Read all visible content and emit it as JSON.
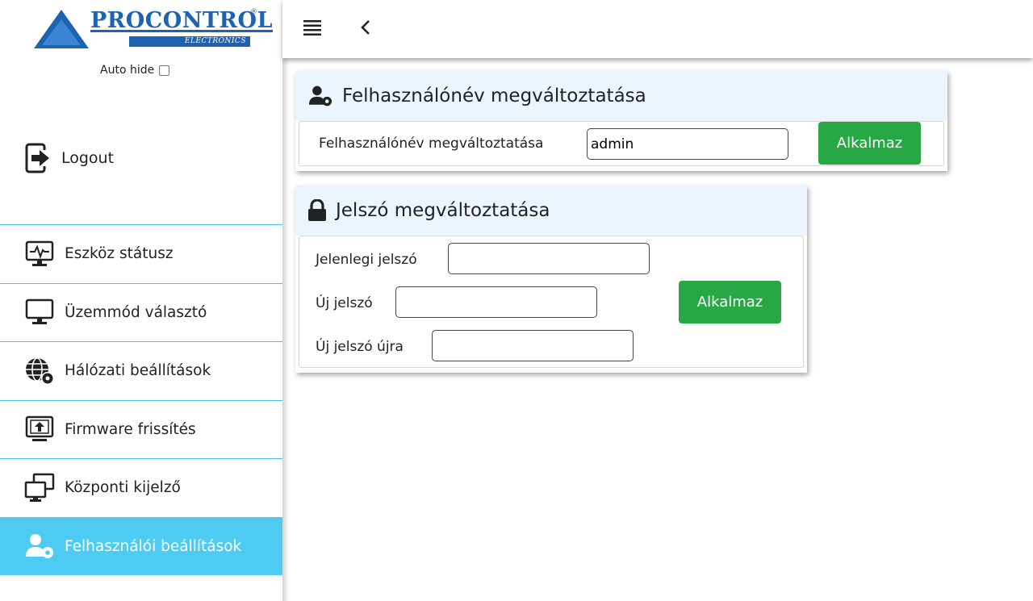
{
  "logo": {
    "brand": "PROCONTROL",
    "subtitle": "ELECTRONICS",
    "registered": "®"
  },
  "sidebar": {
    "autohide_label": "Auto hide",
    "logout_label": "Logout",
    "items": [
      {
        "label": "Eszköz státusz",
        "icon": "monitor-pulse-icon"
      },
      {
        "label": "Üzemmód választó",
        "icon": "monitor-icon"
      },
      {
        "label": "Hálózati beállítások",
        "icon": "globe-gear-icon"
      },
      {
        "label": "Firmware frissítés",
        "icon": "monitor-upload-icon"
      },
      {
        "label": "Központi kijelző",
        "icon": "dual-monitor-icon"
      },
      {
        "label": "Felhasználói beállítások",
        "icon": "user-gear-icon",
        "active": true
      }
    ]
  },
  "username_card": {
    "title": "Felhasználónév megváltoztatása",
    "field_label": "Felhasználónév megváltoztatása",
    "value": "admin",
    "button": "Alkalmaz"
  },
  "password_card": {
    "title": "Jelszó megváltoztatása",
    "current_label": "Jelenlegi jelszó",
    "new_label": "Új jelszó",
    "repeat_label": "Új jelszó újra",
    "button": "Alkalmaz"
  },
  "colors": {
    "accent": "#4ecbf3",
    "divider": "#47c3ea",
    "button": "#28a745",
    "card_header": "#ebf5fe",
    "brand": "#1e63b0"
  }
}
